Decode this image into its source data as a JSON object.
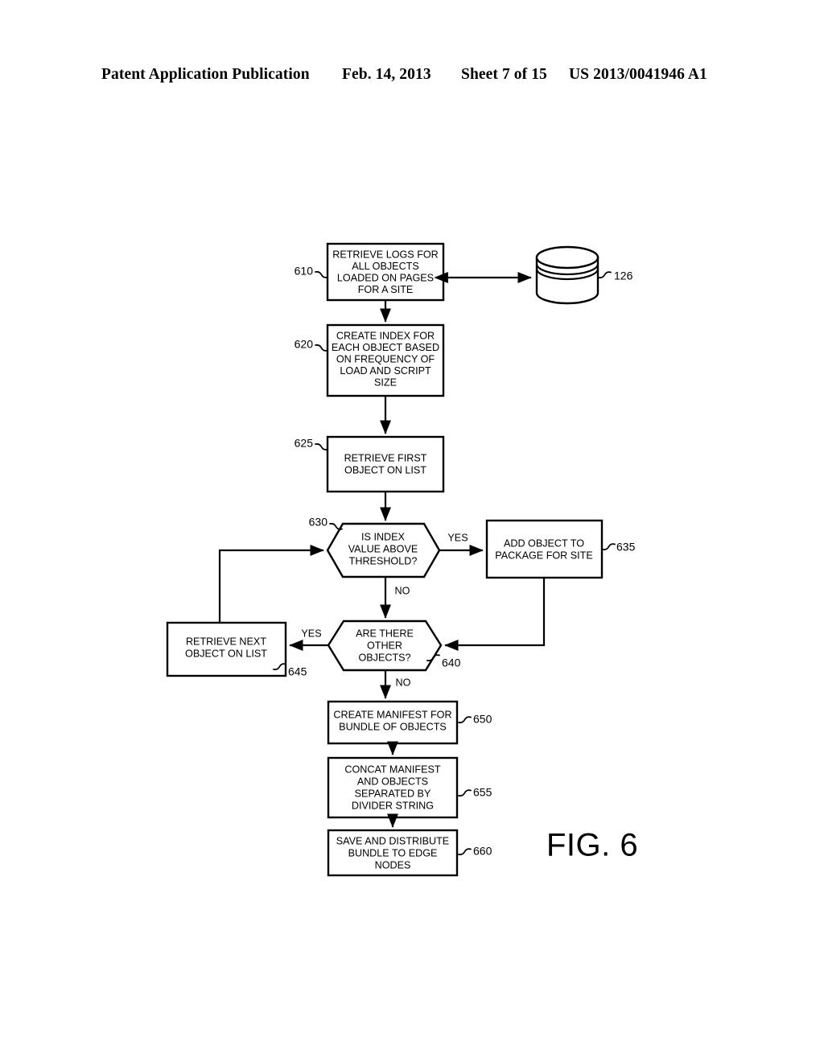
{
  "header": {
    "publication": "Patent Application Publication",
    "date": "Feb. 14, 2013",
    "sheet": "Sheet 7 of 15",
    "document_number": "US 2013/0041946 A1"
  },
  "figure": {
    "label": "FIG. 6",
    "nodes": {
      "n610": {
        "ref": "610",
        "type": "process",
        "lines": [
          "RETRIEVE LOGS FOR",
          "ALL OBJECTS",
          "LOADED ON PAGES",
          "FOR A SITE"
        ]
      },
      "n620": {
        "ref": "620",
        "type": "process",
        "lines": [
          "CREATE INDEX FOR",
          "EACH OBJECT BASED",
          "ON FREQUENCY OF",
          "LOAD AND SCRIPT",
          "SIZE"
        ]
      },
      "n625": {
        "ref": "625",
        "type": "process",
        "lines": [
          "RETRIEVE FIRST",
          "OBJECT ON LIST"
        ]
      },
      "n630": {
        "ref": "630",
        "type": "decision",
        "lines": [
          "IS INDEX",
          "VALUE ABOVE",
          "THRESHOLD?"
        ]
      },
      "n635": {
        "ref": "635",
        "type": "process",
        "lines": [
          "ADD OBJECT TO",
          "PACKAGE FOR SITE"
        ]
      },
      "n640": {
        "ref": "640",
        "type": "decision",
        "lines": [
          "ARE THERE",
          "OTHER",
          "OBJECTS?"
        ]
      },
      "n645": {
        "ref": "645",
        "type": "process",
        "lines": [
          "RETRIEVE NEXT",
          "OBJECT ON LIST"
        ]
      },
      "n650": {
        "ref": "650",
        "type": "process",
        "lines": [
          "CREATE MANIFEST FOR",
          "BUNDLE OF OBJECTS"
        ]
      },
      "n655": {
        "ref": "655",
        "type": "process",
        "lines": [
          "CONCAT MANIFEST",
          "AND OBJECTS",
          "SEPARATED BY",
          "DIVIDER STRING"
        ]
      },
      "n660": {
        "ref": "660",
        "type": "process",
        "lines": [
          "SAVE AND DISTRIBUTE",
          "BUNDLE TO EDGE",
          "NODES"
        ]
      },
      "ndb": {
        "ref": "126",
        "type": "database",
        "lines": []
      }
    },
    "branch_labels": {
      "yes_630": "YES",
      "no_630": "NO",
      "yes_640": "YES",
      "no_640": "NO"
    }
  }
}
